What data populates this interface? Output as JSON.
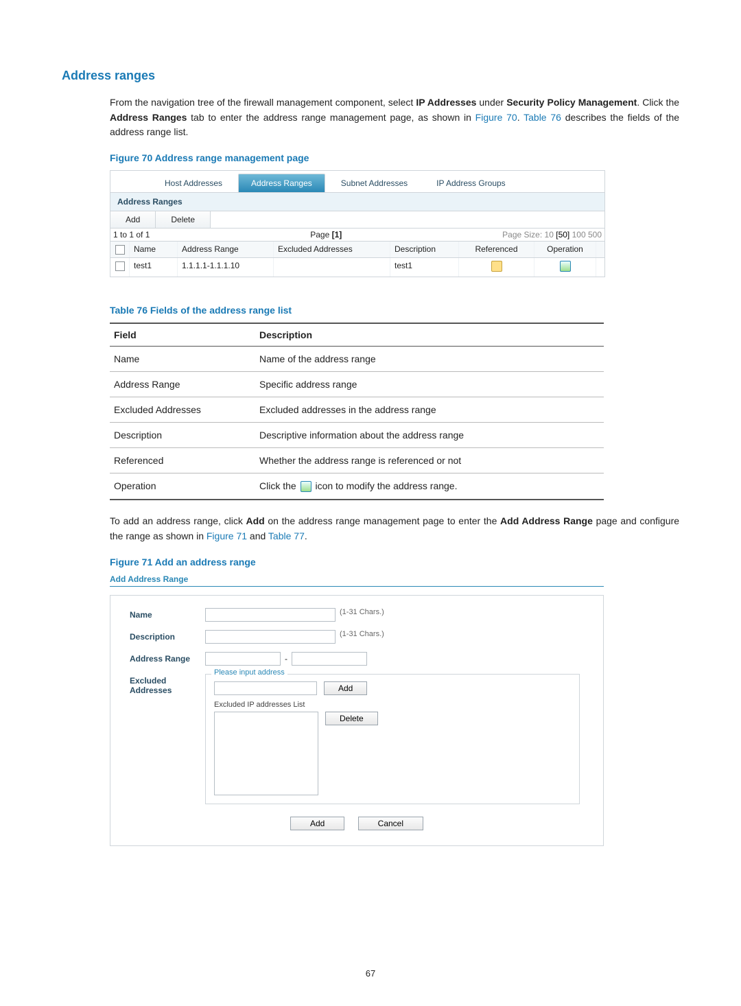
{
  "section_title": "Address ranges",
  "intro": {
    "pre": "From the navigation tree of the firewall management component, select ",
    "bold1": "IP Addresses",
    "mid1": " under ",
    "bold2": "Security Policy Management",
    "mid2": ". Click the ",
    "bold3": "Address Ranges",
    "mid3": " tab to enter the address range management page, as shown in ",
    "link1": "Figure 70",
    "mid4": ". ",
    "link2": "Table 76",
    "post": " describes the fields of the address range list."
  },
  "figure70": {
    "caption": "Figure 70 Address range management page",
    "tabs": {
      "host": "Host Addresses",
      "ranges": "Address Ranges",
      "subnet": "Subnet Addresses",
      "groups": "IP Address Groups"
    },
    "panel_label": "Address Ranges",
    "toolbar": {
      "add": "Add",
      "delete": "Delete"
    },
    "pager": {
      "count": "1 to 1 of 1",
      "page_label": "Page",
      "page_num": "[1]",
      "size_label": "Page Size:",
      "s10": "10",
      "s50": "[50]",
      "s100": "100",
      "s500": "500"
    },
    "columns": {
      "name": "Name",
      "range": "Address Range",
      "excl": "Excluded Addresses",
      "desc": "Description",
      "ref": "Referenced",
      "op": "Operation"
    },
    "row": {
      "name": "test1",
      "range": "1.1.1.1-1.1.1.10",
      "excl": "",
      "desc": "test1"
    }
  },
  "table76": {
    "caption": "Table 76 Fields of the address range list",
    "head": {
      "field": "Field",
      "desc": "Description"
    },
    "rows": {
      "name": {
        "f": "Name",
        "d": "Name of the address range"
      },
      "range": {
        "f": "Address Range",
        "d": "Specific address range"
      },
      "excl": {
        "f": "Excluded Addresses",
        "d": "Excluded addresses in the address range"
      },
      "desc": {
        "f": "Description",
        "d": "Descriptive information about the address range"
      },
      "ref": {
        "f": "Referenced",
        "d": "Whether the address range is referenced or not"
      },
      "op": {
        "f": "Operation",
        "d_pre": "Click the ",
        "d_post": " icon to modify the address range."
      }
    }
  },
  "para2": {
    "pre": "To add an address range, click ",
    "bold1": "Add",
    "mid1": " on the address range management page to enter the ",
    "bold2": "Add Address Range",
    "mid2": " page and configure the range as shown in ",
    "link1": "Figure 71",
    "mid3": " and ",
    "link2": "Table 77",
    "post": "."
  },
  "figure71": {
    "caption": "Figure 71 Add an address range",
    "title": "Add Address Range",
    "labels": {
      "name": "Name",
      "desc": "Description",
      "range": "Address Range",
      "excl": "Excluded Addresses"
    },
    "hints": {
      "name": "(1-31 Chars.)",
      "desc": "(1-31 Chars.)"
    },
    "range_sep": "-",
    "fieldset_legend": "Please input address",
    "add_btn": "Add",
    "list_label": "Excluded IP addresses List",
    "delete_btn": "Delete",
    "bottom_add": "Add",
    "bottom_cancel": "Cancel"
  },
  "page_number": "67"
}
